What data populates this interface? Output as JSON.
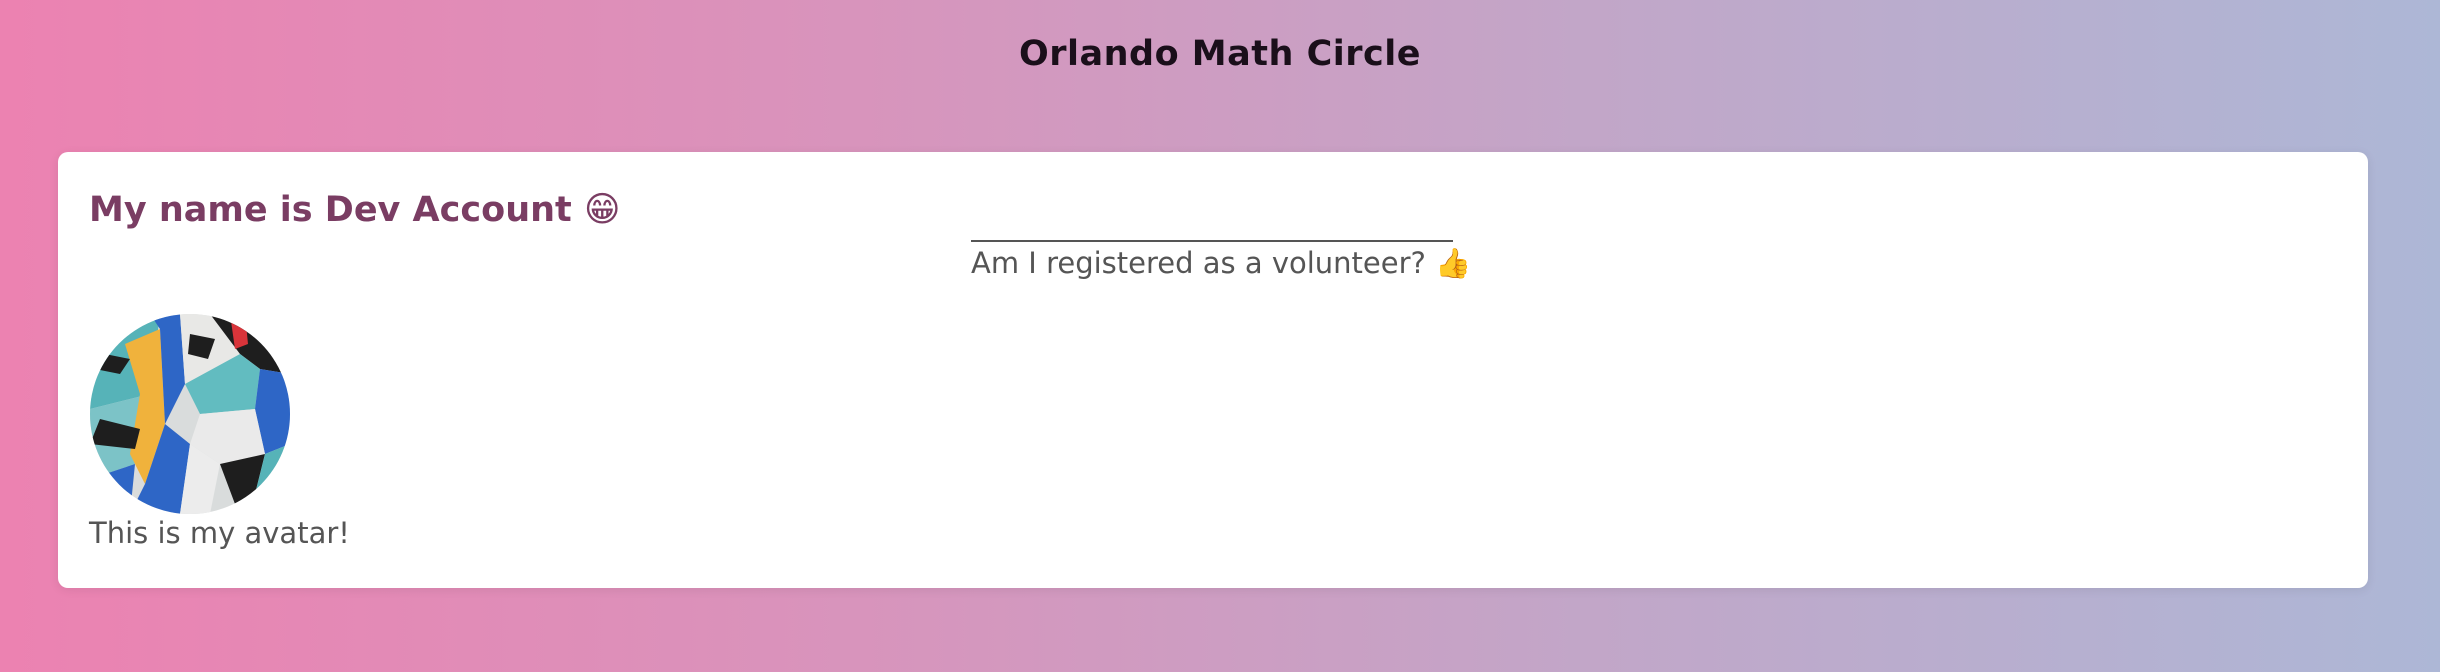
{
  "header": {
    "site_title": "Orlando Math Circle"
  },
  "profile": {
    "name_heading": "My name is Dev Account 😁",
    "volunteer_question": "Am I registered as a volunteer? 👍",
    "avatar_caption": "This is my avatar!"
  },
  "colors": {
    "heading": "#7a3d63",
    "body_text": "#555555",
    "title": "#1a0f1a"
  }
}
